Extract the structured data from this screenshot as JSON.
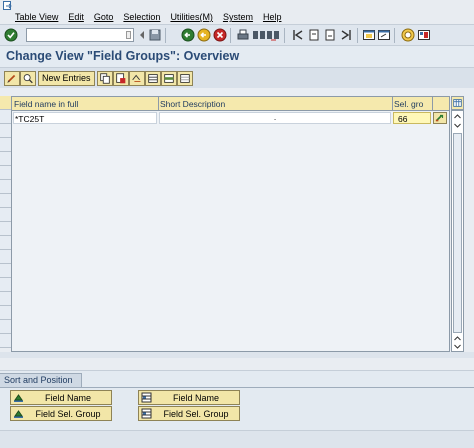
{
  "menu": {
    "items": [
      "Table View",
      "Edit",
      "Goto",
      "Selection",
      "Utilities(M)",
      "System",
      "Help"
    ]
  },
  "toolbar": {
    "command_value": "",
    "icons": [
      "enter-icon",
      "back-icon",
      "exit-icon",
      "cancel-icon",
      "print-icon",
      "find-icon",
      "find-next-icon",
      "first-page-icon",
      "previous-page-icon",
      "next-page-icon",
      "last-page-icon",
      "new-session-icon",
      "shortcut-icon",
      "help-icon",
      "layout-icon"
    ]
  },
  "title": "Change View \"Field Groups\": Overview",
  "app_toolbar": {
    "new_entries_label": "New Entries"
  },
  "table": {
    "columns": [
      "Field name in full",
      "Short Description",
      "Sel. gro"
    ],
    "rows": [
      {
        "field_name": "*TC25T",
        "short_description": "·",
        "sel_group": "66"
      }
    ]
  },
  "sort_position": {
    "title": "Sort and Position",
    "left_buttons": [
      "Field Name",
      "Field Sel. Group"
    ],
    "right_buttons": [
      "Field Name",
      "Field Sel. Group"
    ]
  },
  "colors": {
    "title_text": "#2b4b76",
    "header_yellow": "#f5e9ad",
    "button_yellow": "#f2e6a8",
    "value_yellow": "#fff8b8"
  }
}
